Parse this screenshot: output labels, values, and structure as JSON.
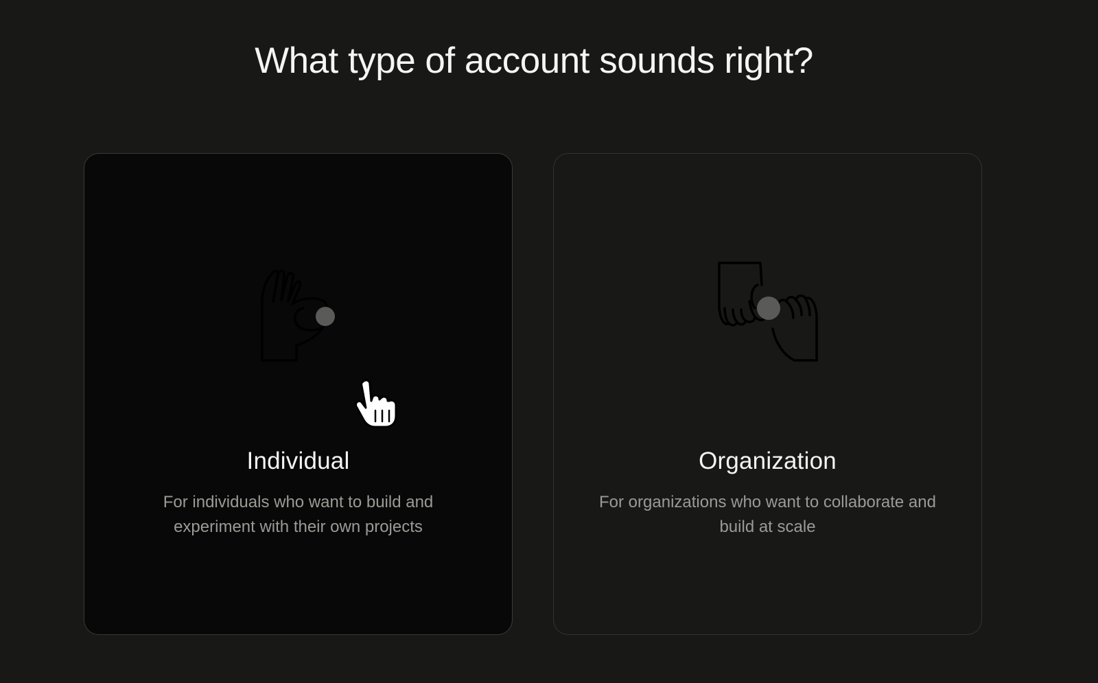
{
  "page": {
    "title": "What type of account sounds right?"
  },
  "cards": [
    {
      "id": "individual",
      "title": "Individual",
      "description": "For individuals who want to build and experiment with their own projects",
      "icon": "ok-hand-icon",
      "hovered": true
    },
    {
      "id": "organization",
      "title": "Organization",
      "description": "For organizations who want to collaborate and build at scale",
      "icon": "handshake-icon",
      "hovered": false
    }
  ],
  "cursor": {
    "icon": "pointer-hand-cursor"
  },
  "colors": {
    "background": "#181817",
    "card_hover": "#080808",
    "text_primary": "#f4f4f2",
    "text_secondary": "#9a9a96",
    "icon_dot": "#5a5a58"
  }
}
